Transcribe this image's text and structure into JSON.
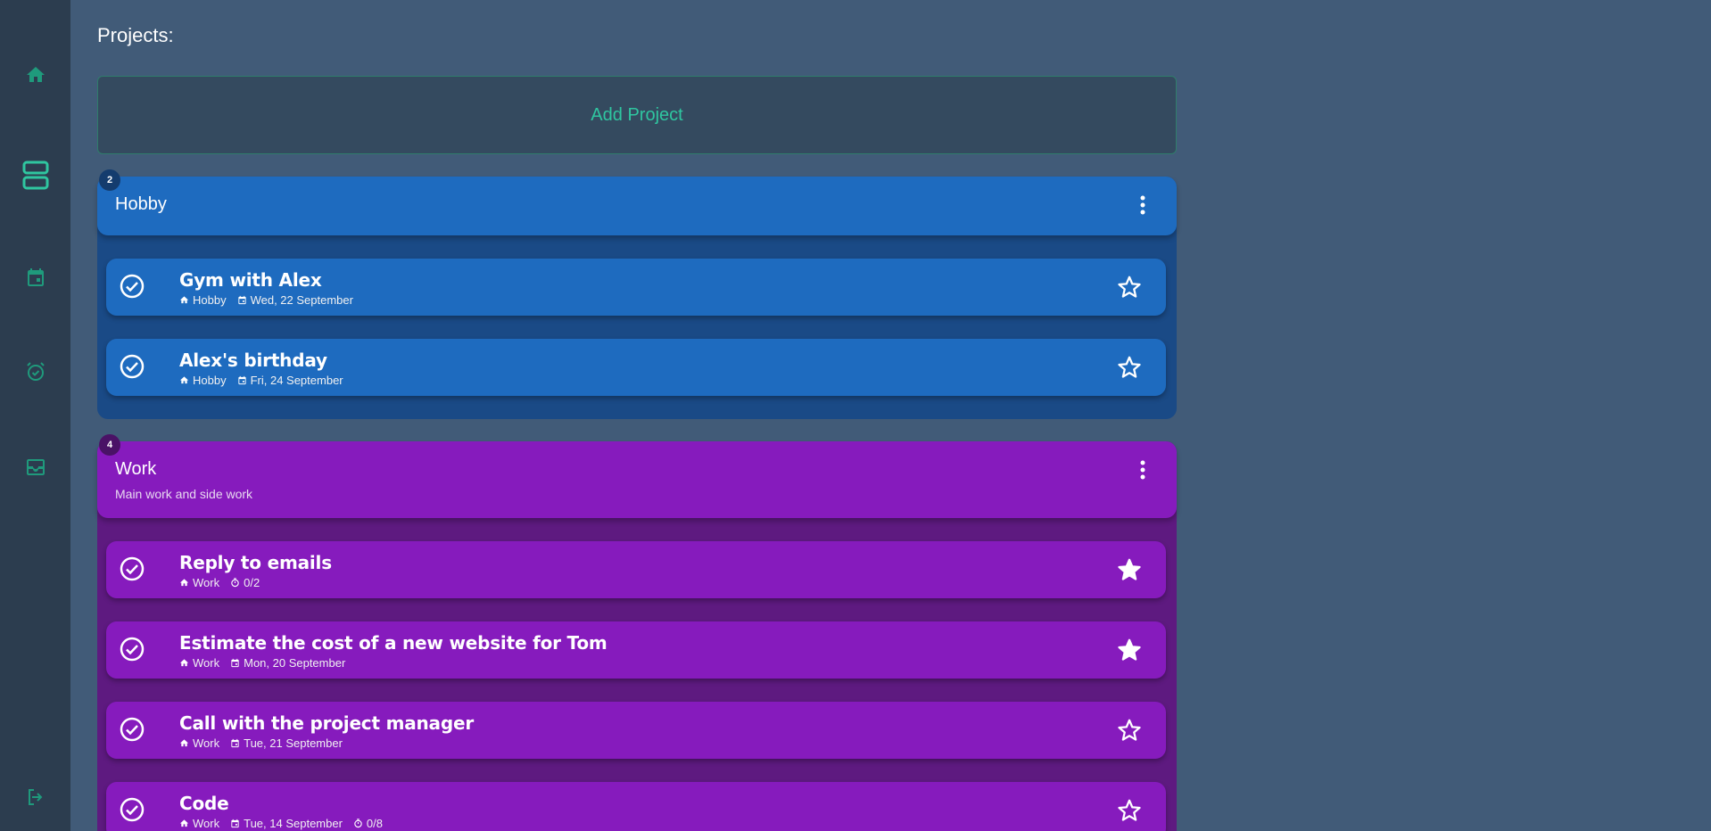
{
  "page": {
    "title": "Projects:"
  },
  "add_project": {
    "label": "Add Project"
  },
  "colors": {
    "accent": "#2fc6a0",
    "hobby": "#1e6bbf",
    "work": "#861bbd"
  },
  "sidebar": {
    "items": [
      {
        "icon": "home-icon"
      },
      {
        "icon": "projects-icon"
      },
      {
        "icon": "calendar-icon"
      },
      {
        "icon": "alarm-check-icon"
      },
      {
        "icon": "archive-icon"
      },
      {
        "icon": "logout-icon"
      }
    ]
  },
  "projects": [
    {
      "name": "Hobby",
      "description": "",
      "count": "2",
      "tasks": [
        {
          "title": "Gym with Alex",
          "project": "Hobby",
          "date": "Wed, 22 September",
          "starred": false
        },
        {
          "title": "Alex's birthday",
          "project": "Hobby",
          "date": "Fri, 24 September",
          "starred": false
        }
      ]
    },
    {
      "name": "Work",
      "description": "Main work and side work",
      "count": "4",
      "tasks": [
        {
          "title": "Reply to emails",
          "project": "Work",
          "timer": "0/2",
          "starred": true
        },
        {
          "title": "Estimate the cost of a new website for Tom",
          "project": "Work",
          "date": "Mon, 20 September",
          "starred": true
        },
        {
          "title": "Call with the project manager",
          "project": "Work",
          "date": "Tue, 21 September",
          "starred": false
        },
        {
          "title": "Code",
          "project": "Work",
          "date": "Tue, 14 September",
          "timer": "0/8",
          "starred": false
        }
      ]
    }
  ]
}
